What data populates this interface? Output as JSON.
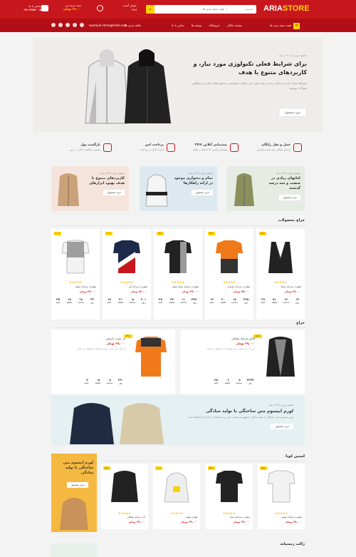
{
  "header": {
    "logo_a": "ARIA",
    "logo_b": "STORE",
    "search_placeholder": "جستجو",
    "search_category": "همه دسته بندی ها",
    "cart_title": "سبد خرید من",
    "cart_total": "۲۹۰۰۰ تومان",
    "account_title": "خوش آمدید",
    "account_sub": "ورود",
    "phone_title": "تماس با ما",
    "phone": "۰۲۱-۶۶۵۶۰۰۵"
  },
  "nav": {
    "categories": "همه دسته بندی ها",
    "items": [
      "صفحه خانگی",
      "فروشگاه",
      "نوشته ها",
      "تماس با ما"
    ],
    "wishlist": "علاقه مندی ها",
    "email": "example.store@email.com"
  },
  "hero": {
    "small": "تخفیف ویژه تا ۷۰ درصد",
    "title": "برای شرایط فعلی تکنولوژی مورد نیاز، و کاربردهای متنوع با هدف",
    "desc": "شرایط سخت تایپ به پایان رسد و زمان مورد نیاز شامل حروفچینی دستاوردهای اصلی و جوابگوی سوالات پیوسته",
    "button": "خرید محصول"
  },
  "features": [
    {
      "title": "حمل و نقل رایگان",
      "desc": "ارسال رایگان برای همه سفارش"
    },
    {
      "title": "پشتیبانی آنلاین ۲۴/۷",
      "desc": "پشتیبانی آنلاین ۲۴ ساعته در هفته"
    },
    {
      "title": "پرداخت امن",
      "desc": "امنیت کامل در پرداخت"
    },
    {
      "title": "بازگشت پول",
      "desc": "تضمین بازگشت ۷ الی ۱۰ روز"
    }
  ],
  "promos": [
    {
      "small": "تخفیف ویژه تا ۲۵ درصد",
      "title": "کتابهای زیادی در شصت و سه درصد گذشته",
      "button": "خرید محصول"
    },
    {
      "small": "تخفیف ویژه تا ۲۵ درصد",
      "title": "تمام و دشواری موجود در ارائه راهکارها",
      "button": "خرید محصول"
    },
    {
      "small": "تخفیف ویژه تا ۲۵ درصد",
      "title": "کاربردهای متنوع با هدف بهبود ابزارهای",
      "button": "خرید محصول"
    }
  ],
  "sale_title": "حراج محصولات",
  "products": [
    {
      "badge": "-۱۵٪",
      "name": "تیشرت مردانه سیاه",
      "price": "۳۹,۰۰۰ تومان",
      "cd": [
        [
          "۱۷",
          "روز"
        ],
        [
          "۱۴",
          "ساعت"
        ],
        [
          "۵۱",
          "دقیقه"
        ],
        [
          "۲۹",
          "ثانیه"
        ]
      ]
    },
    {
      "badge": "-۲۴٪",
      "name": "تیشرت مردانه نارنجی",
      "price": "۴۵,۰۰۰ تومان",
      "cd": [
        [
          "۲۳۵",
          "روز"
        ],
        [
          "۱۸",
          "ساعت"
        ],
        [
          "۴۰",
          "دقیقه"
        ],
        [
          "۱۲",
          "ثانیه"
        ]
      ]
    },
    {
      "badge": "-۱۸٪",
      "name": "تیشرت مردانه سیاه سفید",
      "price": "۳۹,۰۰۰ تومان",
      "cd": [
        [
          "۲۹۷۰",
          "روز"
        ],
        [
          "۱۱",
          "ساعت"
        ],
        [
          "۳۳",
          "دقیقه"
        ],
        [
          "۴۸",
          "ثانیه"
        ]
      ]
    },
    {
      "badge": "-۲۰٪",
      "name": "تیشرت مردانه آبی",
      "price": "۴۲,۰۰۰ تومان",
      "cd": [
        [
          "۴۰۱",
          "روز"
        ],
        [
          "۰۵",
          "ساعت"
        ],
        [
          "۲۱",
          "دقیقه"
        ],
        [
          "۱۸",
          "ثانیه"
        ]
      ]
    },
    {
      "badge": "-۱۰٪",
      "name": "تیشرت مردانه سفید",
      "price": "۳۹,۰۰۰ تومان",
      "cd": [
        [
          "۳۳",
          "روز"
        ],
        [
          "۱۸",
          "ساعت"
        ],
        [
          "۱۸",
          "دقیقه"
        ],
        [
          "۳۵",
          "ثانیه"
        ]
      ]
    }
  ],
  "deal_title": "حراج",
  "deals": [
    {
      "badge": "-۱۵٪",
      "name": "لباس مردانه مشکی",
      "price": "۳۹,۰۰۰ تومان",
      "desc": "این یک متن تستی برای توضیحات محصول می باشد",
      "cd": [
        [
          "۴۳۳۹",
          "روز"
        ],
        [
          "۰۸",
          "ساعت"
        ],
        [
          "۰۶",
          "دقیقه"
        ],
        [
          "۳۵",
          "ثانیه"
        ]
      ]
    },
    {
      "badge": "-۲۴٪",
      "name": "تی شرت نارنجی",
      "price": "۳۹,۰۰۰ تومان",
      "desc": "این یک متن تستی برای توضیحات محصول می باشد",
      "cd": [
        [
          "۲۹۰",
          "روز"
        ],
        [
          "۰۸",
          "ساعت"
        ],
        [
          "۰۵",
          "دقیقه"
        ],
        [
          "۰۴",
          "ثانیه"
        ]
      ]
    }
  ],
  "banner": {
    "small": "تخفیف ویژه تا ۲۵ درصد",
    "title": "لورم ایپسوم متن ساختگی با تولید سادگی",
    "desc": "لورم ایپسوم متن ساختگی با تولید سادگی نامفهوم از صنعت چاپ و با استفاده از طراحان گرافیک است",
    "button": "خرید محصول"
  },
  "new_title": "استین کوتا",
  "side": {
    "title": "لورم ایپسوم متن ساختگی با تولید سادگی",
    "button": "خرید محصول"
  },
  "new_products": [
    {
      "badge": "-۱۵٪",
      "name": "کت مردانه مشکی",
      "price": "۳۹,۰۰۰ تومان"
    },
    {
      "badge": "-۱۰٪",
      "name": "هودی سفید",
      "price": "۳۹,۰۰۰ تومان"
    },
    {
      "badge": "-۲۴٪",
      "name": "تیشرت مردانه سیاه",
      "price": "۳۹,۰۰۰ تومان"
    },
    {
      "badge": "-۱۵٪",
      "name": "تیشرت مردانه سفید",
      "price": "۳۹,۰۰۰ تومان"
    }
  ],
  "winter_title": "ژاکت زمستانه",
  "stars": "★★★★★"
}
